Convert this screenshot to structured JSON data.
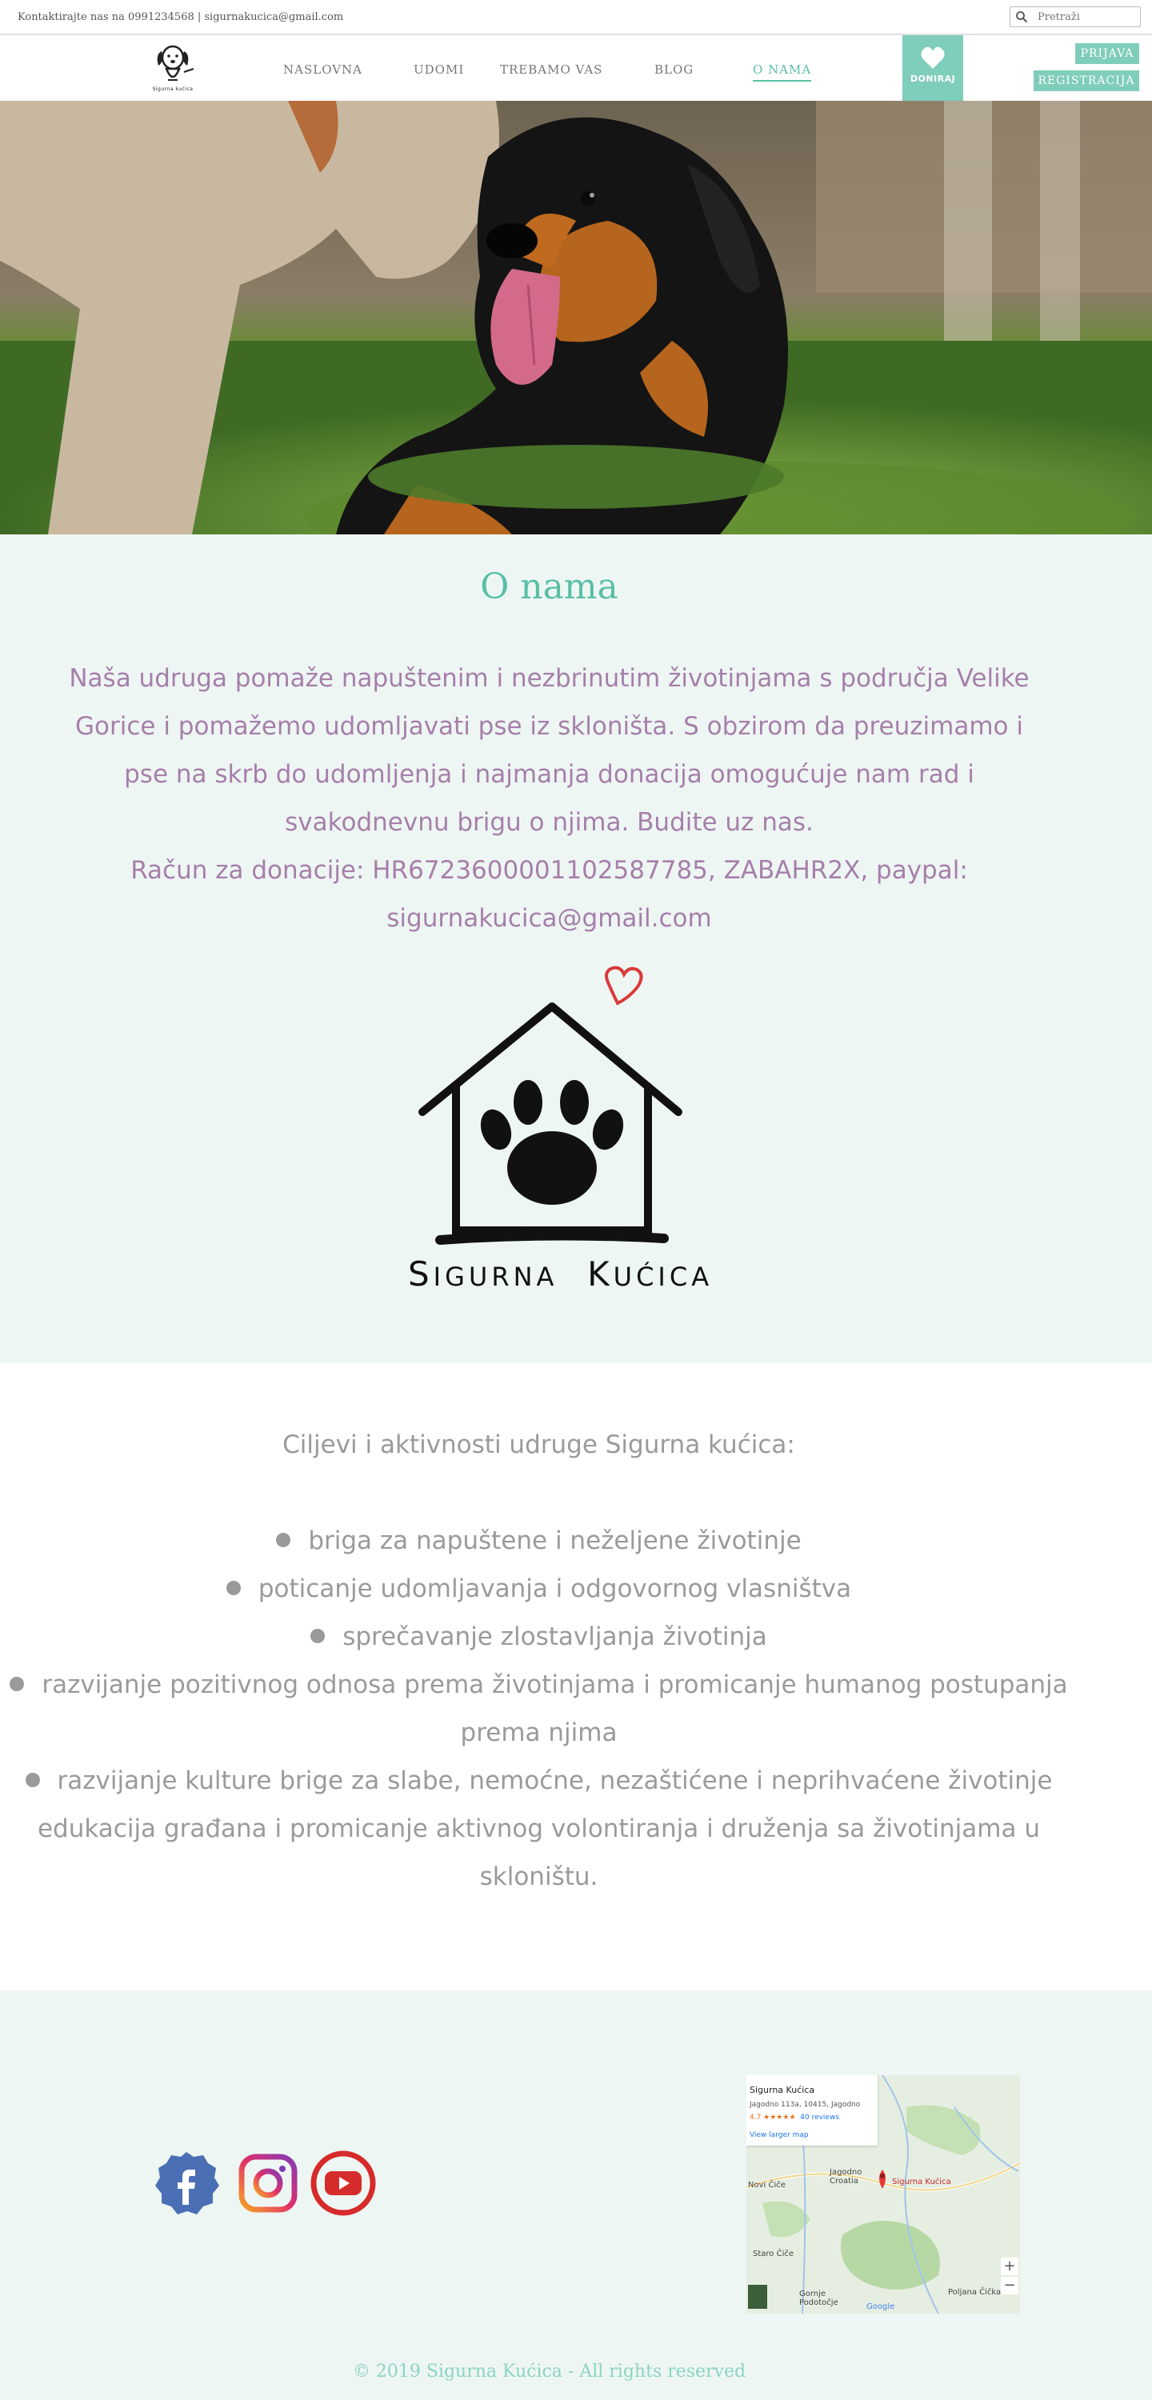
{
  "topbar": {
    "contact": "Kontaktirajte nas na 0991234568 |  sigurnakucica@gmail.com",
    "search_placeholder": "Pretraži",
    "search_icon": "search-icon"
  },
  "nav": {
    "logo_caption": "Sigurna kućica",
    "items": [
      {
        "label": "NASLOVNA",
        "active": false
      },
      {
        "label": "UDOMI",
        "active": false
      },
      {
        "label": "TREBAMO VAS",
        "active": false
      },
      {
        "label": "BLOG",
        "active": false
      },
      {
        "label": "O NAMA",
        "active": true
      }
    ],
    "donate_label": "DONIRAJ",
    "donate_icon": "heart-icon",
    "login_label": "PRIJAVA",
    "register_label": "REGISTRACIJA"
  },
  "about": {
    "title": "O nama",
    "paragraph": "Naša udruga pomaže napuštenim i nezbrinutim životinjama s područja Velike Gorice i pomažemo udomljavati pse iz skloništa. S obzirom da preuzimamo i pse na skrb do udomljenja i najmanja donacija omogućuje nam rad i svakodnevnu brigu o njima. Budite uz nas.",
    "account": "Račun za donacije: HR6723600001102587785, ZABAHR2X, paypal: sigurnakucica@gmail.com",
    "brand_name_big1": "S",
    "brand_name_small1": "IGURNA",
    "brand_name_big2": "K",
    "brand_name_small2": "UĆICA"
  },
  "goals": {
    "intro": "Ciljevi i aktivnosti udruge Sigurna kućica:",
    "items": [
      "briga za napuštene i neželjene životinje",
      "poticanje udomljavanja i odgovornog vlasništva",
      "sprečavanje zlostavljanja životinja",
      "razvijanje pozitivnog odnosa prema životinjama i promicanje humanog postupanja",
      "prema njima",
      "razvijanje kulture brige za slabe, nemoćne, nezaštićene i neprihvaćene životinje",
      "edukacija građana i promicanje aktivnog volontiranja i druženja sa životinjama u",
      "skloništu."
    ]
  },
  "footer": {
    "social_icons": [
      "facebook-icon",
      "instagram-icon",
      "youtube-icon"
    ],
    "map": {
      "place": "Sigurna Kućica",
      "address": "Jagodno 113a, 10415, Jagodno",
      "rating": "4.7 ★★★★★",
      "reviews": "40 reviews",
      "larger": "View larger map",
      "pin_label": "Sigurna Kućica",
      "places": [
        "Novi Čiče",
        "Jagodno Croatia",
        "Staro Čiče",
        "Gornje Podotočje",
        "Poljana Čička"
      ],
      "zoom_in": "+",
      "zoom_out": "−",
      "google": "Google"
    },
    "copyright": "© 2019 Sigurna Kućica - All rights reserved"
  },
  "colors": {
    "accent": "#59bfa6",
    "button": "#7fcdbb",
    "text_purple": "#a67fab",
    "section_bg": "#eef6f3"
  }
}
